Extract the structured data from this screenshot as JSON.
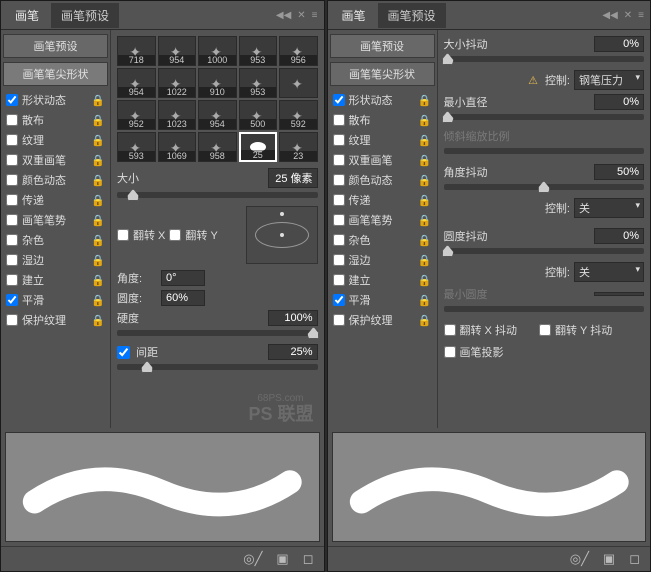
{
  "tabs": {
    "brush": "画笔",
    "preset": "画笔预设"
  },
  "sidebar": {
    "presetBtn": "画笔预设",
    "tipBtn": "画笔笔尖形状",
    "items": [
      {
        "label": "形状动态",
        "checked": true
      },
      {
        "label": "散布",
        "checked": false
      },
      {
        "label": "纹理",
        "checked": false
      },
      {
        "label": "双重画笔",
        "checked": false
      },
      {
        "label": "颜色动态",
        "checked": false
      },
      {
        "label": "传递",
        "checked": false
      },
      {
        "label": "画笔笔势",
        "checked": false
      },
      {
        "label": "杂色",
        "checked": false
      },
      {
        "label": "湿边",
        "checked": false
      },
      {
        "label": "建立",
        "checked": false
      },
      {
        "label": "平滑",
        "checked": true
      },
      {
        "label": "保护纹理",
        "checked": false
      }
    ]
  },
  "left": {
    "thumbs": [
      {
        "n": "718"
      },
      {
        "n": "954"
      },
      {
        "n": "1000"
      },
      {
        "n": "953"
      },
      {
        "n": "956"
      },
      {
        "n": "954"
      },
      {
        "n": "1022"
      },
      {
        "n": "910"
      },
      {
        "n": "953"
      },
      {
        "n": ""
      },
      {
        "n": "952"
      },
      {
        "n": "1023"
      },
      {
        "n": "954"
      },
      {
        "n": "500"
      },
      {
        "n": "592"
      },
      {
        "n": "593"
      },
      {
        "n": "1069"
      },
      {
        "n": "958"
      },
      {
        "n": "25",
        "sel": true
      },
      {
        "n": "23"
      }
    ],
    "sizeLabel": "大小",
    "sizeVal": "25 像素",
    "flipX": "翻转 X",
    "flipY": "翻转 Y",
    "angleLabel": "角度:",
    "angleVal": "0°",
    "roundLabel": "圆度:",
    "roundVal": "60%",
    "hardLabel": "硬度",
    "hardVal": "100%",
    "spaceLabel": "间距",
    "spaceVal": "25%",
    "watermark": "PS 联盟",
    "wm2": "68PS.com"
  },
  "right": {
    "sizeJitter": "大小抖动",
    "sizeJitterVal": "0%",
    "controlLabel": "控制:",
    "penPressure": "钢笔压力",
    "minDiameter": "最小直径",
    "minDiameterVal": "0%",
    "tiltScale": "倾斜缩放比例",
    "angleJitter": "角度抖动",
    "angleJitterVal": "50%",
    "off": "关",
    "roundJitter": "圆度抖动",
    "roundJitterVal": "0%",
    "minRound": "最小圆度",
    "flipXJitter": "翻转 X 抖动",
    "flipYJitter": "翻转 Y 抖动",
    "brushProj": "画笔投影"
  }
}
